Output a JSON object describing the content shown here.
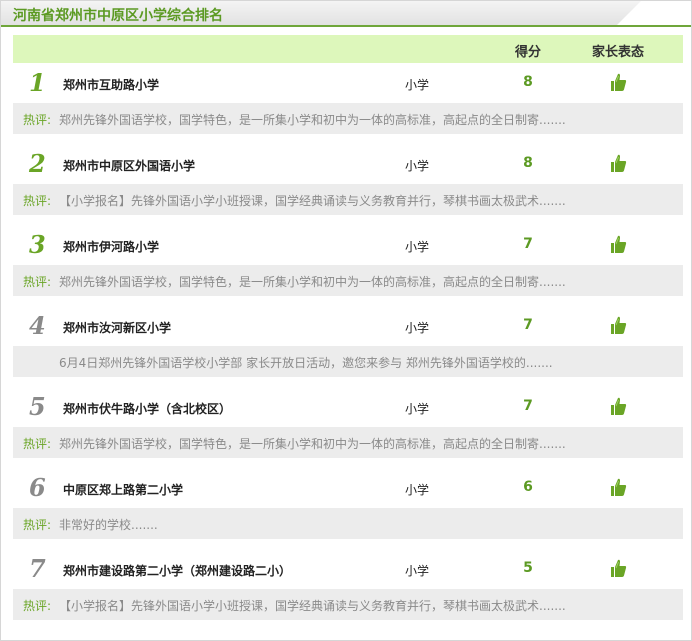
{
  "header": {
    "title": "河南省郑州市中原区小学综合排名"
  },
  "columns": {
    "score": "得分",
    "parent": "家长表态"
  },
  "comment_label": "热评:",
  "colors": {
    "accent_green": "#6aa526",
    "header_green": "#ddf7bb",
    "comment_bg": "#ececec",
    "rank_gray": "#8a8a8a"
  },
  "rows": [
    {
      "rank": "1",
      "name": "郑州市互助路小学",
      "type": "小学",
      "score": "8",
      "comment": "郑州先锋外国语学校，国学特色，是一所集小学和初中为一体的高标准，高起点的全日制寄......."
    },
    {
      "rank": "2",
      "name": "郑州市中原区外国语小学",
      "type": "小学",
      "score": "8",
      "comment": "【小学报名】先锋外国语小学小班授课，国学经典诵读与义务教育并行，琴棋书画太极武术......."
    },
    {
      "rank": "3",
      "name": "郑州市伊河路小学",
      "type": "小学",
      "score": "7",
      "comment": "郑州先锋外国语学校，国学特色，是一所集小学和初中为一体的高标准，高起点的全日制寄......."
    },
    {
      "rank": "4",
      "name": "郑州市汝河新区小学",
      "type": "小学",
      "score": "7",
      "comment": "6月4日郑州先锋外国语学校小学部 家长开放日活动，邀您来参与 郑州先锋外国语学校的......."
    },
    {
      "rank": "5",
      "name": "郑州市伏牛路小学（含北校区）",
      "type": "小学",
      "score": "7",
      "comment": "郑州先锋外国语学校，国学特色，是一所集小学和初中为一体的高标准，高起点的全日制寄......."
    },
    {
      "rank": "6",
      "name": "中原区郑上路第二小学",
      "type": "小学",
      "score": "6",
      "comment": "非常好的学校......."
    },
    {
      "rank": "7",
      "name": "郑州市建设路第二小学（郑州建设路二小）",
      "type": "小学",
      "score": "5",
      "comment": "【小学报名】先锋外国语小学小班授课，国学经典诵读与义务教育并行，琴棋书画太极武术......."
    }
  ]
}
